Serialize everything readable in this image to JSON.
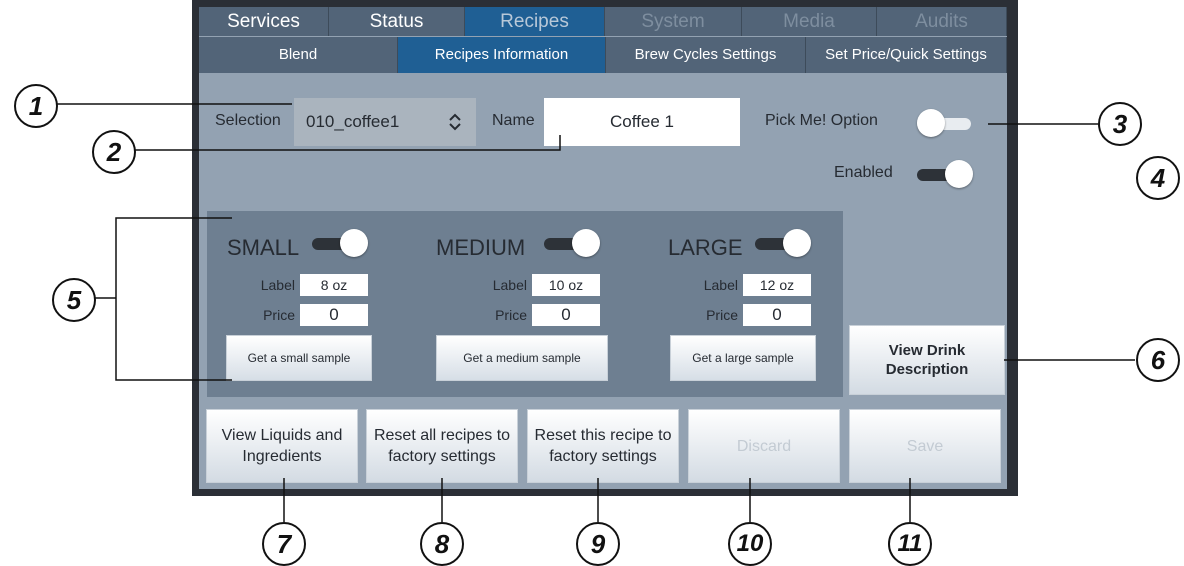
{
  "tabs": [
    {
      "label": "Services",
      "state": "normal"
    },
    {
      "label": "Status",
      "state": "normal"
    },
    {
      "label": "Recipes",
      "state": "active"
    },
    {
      "label": "System",
      "state": "disabled"
    },
    {
      "label": "Media",
      "state": "disabled"
    },
    {
      "label": "Audits",
      "state": "disabled"
    }
  ],
  "subtabs": [
    {
      "label": "Blend",
      "state": "normal"
    },
    {
      "label": "Recipes Information",
      "state": "active"
    },
    {
      "label": "Brew Cycles Settings",
      "state": "normal"
    },
    {
      "label": "Set Price/Quick Settings",
      "state": "normal"
    }
  ],
  "selection": {
    "label": "Selection",
    "value": "010_coffee1",
    "chevron_icon": "up-down-chevron-icon"
  },
  "name": {
    "label": "Name",
    "value": "Coffee 1"
  },
  "pick_me": {
    "label": "Pick Me! Option",
    "on": false
  },
  "enabled": {
    "label": "Enabled",
    "on": true
  },
  "sizes": [
    {
      "title": "SMALL",
      "on": true,
      "label_caption": "Label",
      "label_value": "8 oz",
      "price_caption": "Price",
      "price_value": "0",
      "sample_button": "Get a small sample"
    },
    {
      "title": "MEDIUM",
      "on": true,
      "label_caption": "Label",
      "label_value": "10 oz",
      "price_caption": "Price",
      "price_value": "0",
      "sample_button": "Get a medium sample"
    },
    {
      "title": "LARGE",
      "on": true,
      "label_caption": "Label",
      "label_value": "12 oz",
      "price_caption": "Price",
      "price_value": "0",
      "sample_button": "Get a large sample"
    }
  ],
  "view_drink_description": "View Drink Description",
  "bottom_buttons": [
    {
      "label": "View Liquids and Ingredients",
      "enabled": true
    },
    {
      "label": "Reset all recipes to factory settings",
      "enabled": true
    },
    {
      "label": "Reset this recipe to factory settings",
      "enabled": true
    },
    {
      "label": "Discard",
      "enabled": false
    },
    {
      "label": "Save",
      "enabled": false
    }
  ],
  "callouts": [
    "1",
    "2",
    "3",
    "4",
    "5",
    "6",
    "7",
    "8",
    "9",
    "10",
    "11"
  ]
}
